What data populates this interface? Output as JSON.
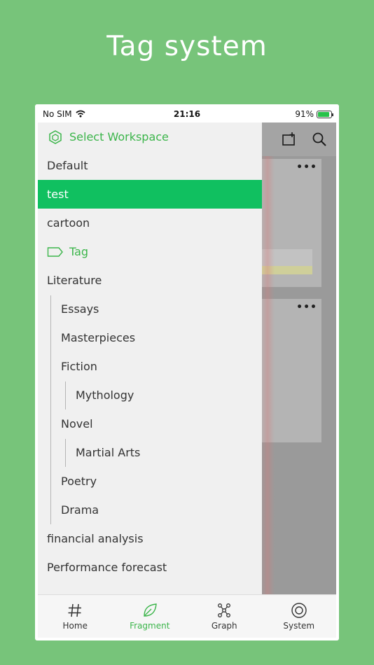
{
  "headline": "Tag system",
  "status_bar": {
    "carrier": "No SIM",
    "time": "21:16",
    "battery": "91%",
    "battery_level": 0.91
  },
  "background_app": {
    "card_menu": "•••"
  },
  "drawer": {
    "workspace_header": "Select Workspace",
    "workspaces": [
      "Default",
      "test",
      "cartoon"
    ],
    "selected_workspace": "test",
    "tag_header": "Tag",
    "tags": {
      "literature": "Literature",
      "essays": "Essays",
      "masterpieces": "Masterpieces",
      "fiction": "Fiction",
      "mythology": "Mythology",
      "novel": "Novel",
      "martial_arts": "Martial Arts",
      "poetry": "Poetry",
      "drama": "Drama",
      "financial_analysis": "financial analysis",
      "performance_forecast": "Performance forecast"
    }
  },
  "tab_bar": {
    "tabs": [
      {
        "label": "Home",
        "icon": "hashtag-icon"
      },
      {
        "label": "Fragment",
        "icon": "leaf-icon"
      },
      {
        "label": "Graph",
        "icon": "graph-icon"
      },
      {
        "label": "System",
        "icon": "target-icon"
      }
    ],
    "active": "Fragment",
    "accent": "#3bb54a"
  },
  "colors": {
    "background": "#77c47a",
    "selected_row": "#10c060",
    "section_green": "#3bb54a"
  }
}
